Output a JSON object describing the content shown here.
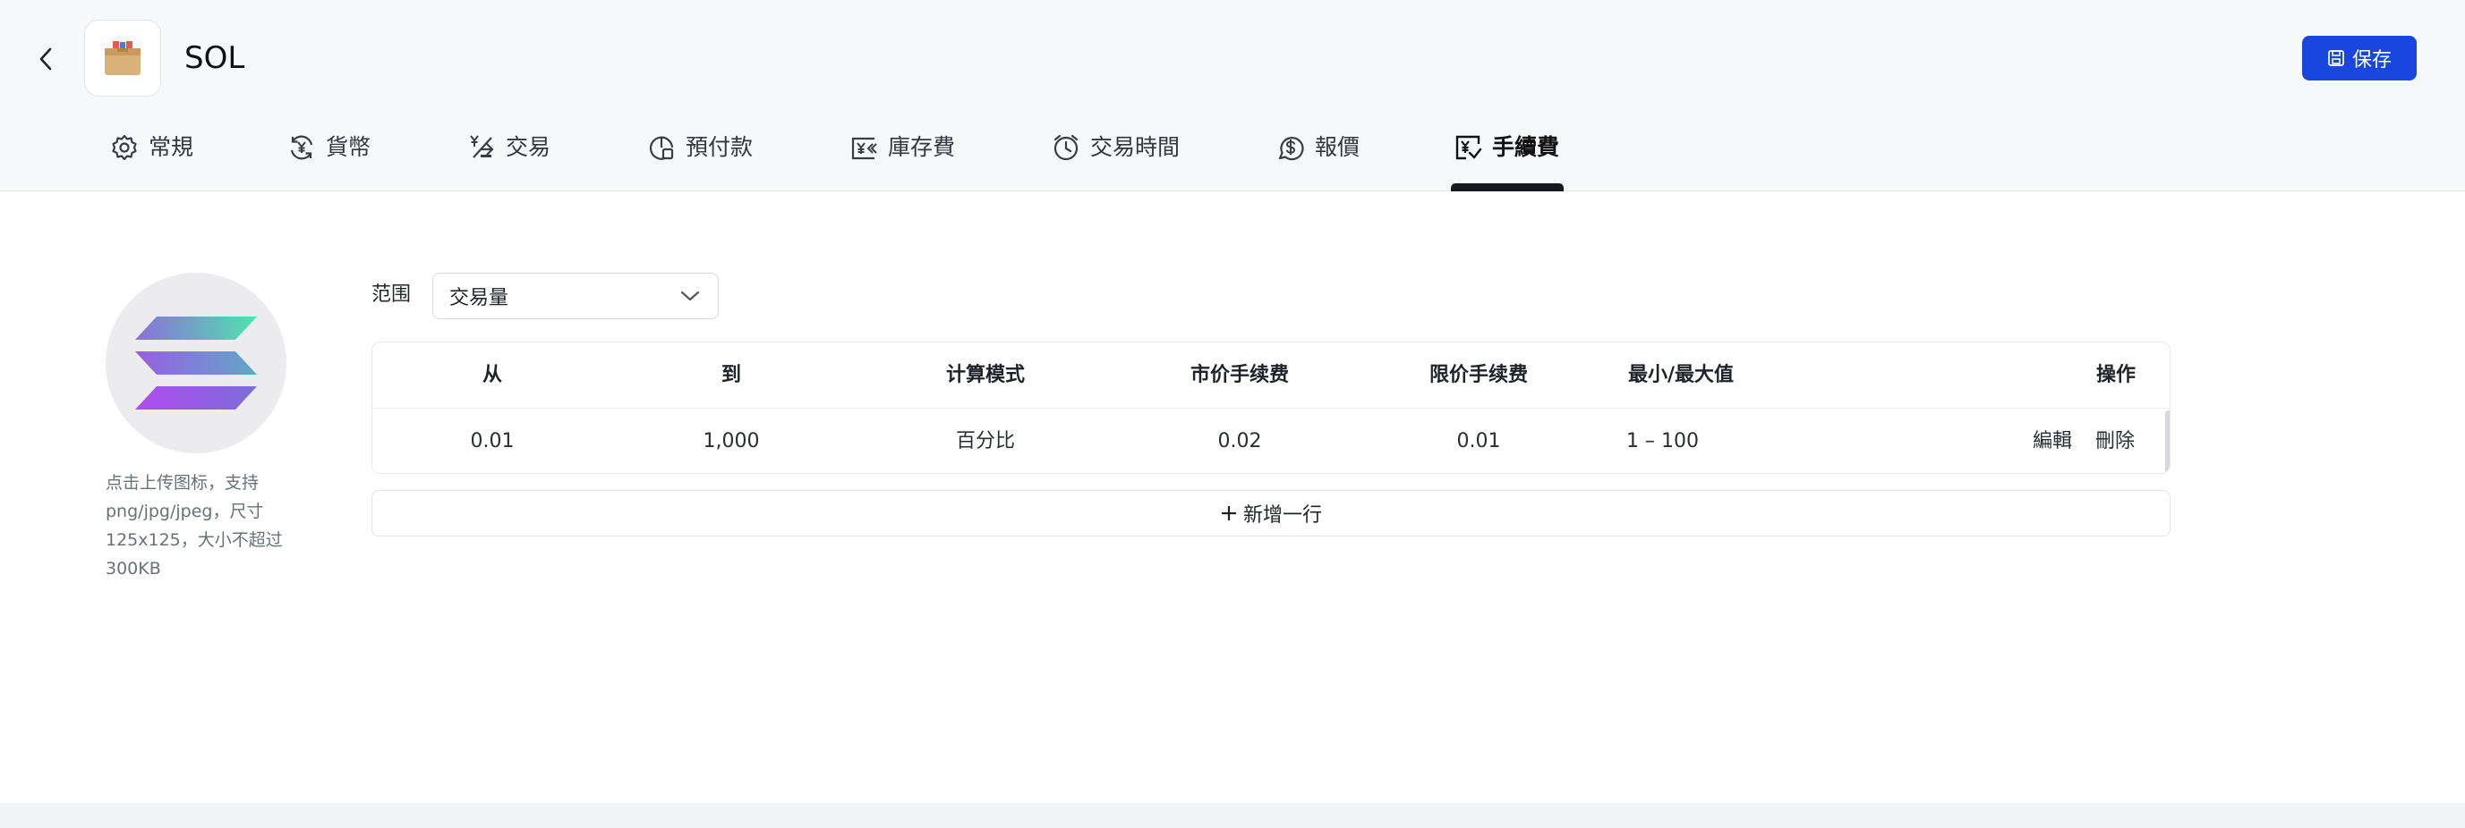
{
  "header": {
    "title": "SOL",
    "save_label": "保存"
  },
  "tabs": [
    {
      "label": "常規",
      "icon": "gear-icon"
    },
    {
      "label": "貨幣",
      "icon": "currency-exchange-icon"
    },
    {
      "label": "交易",
      "icon": "trade-icon"
    },
    {
      "label": "預付款",
      "icon": "prepayment-icon"
    },
    {
      "label": "庫存費",
      "icon": "storage-fee-icon"
    },
    {
      "label": "交易時間",
      "icon": "clock-icon"
    },
    {
      "label": "報價",
      "icon": "quote-dollar-icon"
    },
    {
      "label": "手續費",
      "icon": "fee-icon",
      "active": true
    }
  ],
  "upload": {
    "hint_lines": [
      "点击上传图标，支持",
      "png/jpg/jpeg，尺寸",
      "125x125，大小不超过",
      "300KB"
    ]
  },
  "range": {
    "label": "范围",
    "selected": "交易量"
  },
  "table": {
    "columns": [
      "从",
      "到",
      "计算模式",
      "市价手续费",
      "限价手续费",
      "最小/最大值",
      "操作"
    ],
    "rows": [
      {
        "from": "0.01",
        "to": "1,000",
        "mode": "百分比",
        "market_fee": "0.02",
        "limit_fee": "0.01",
        "min_max": "1 – 100",
        "edit": "編輯",
        "delete": "刪除"
      }
    ]
  },
  "add_row_label": "新增一行",
  "colors": {
    "primary": "#1a46e0",
    "active_tab": "#17191d",
    "header_bg": "#f7f8fa"
  }
}
